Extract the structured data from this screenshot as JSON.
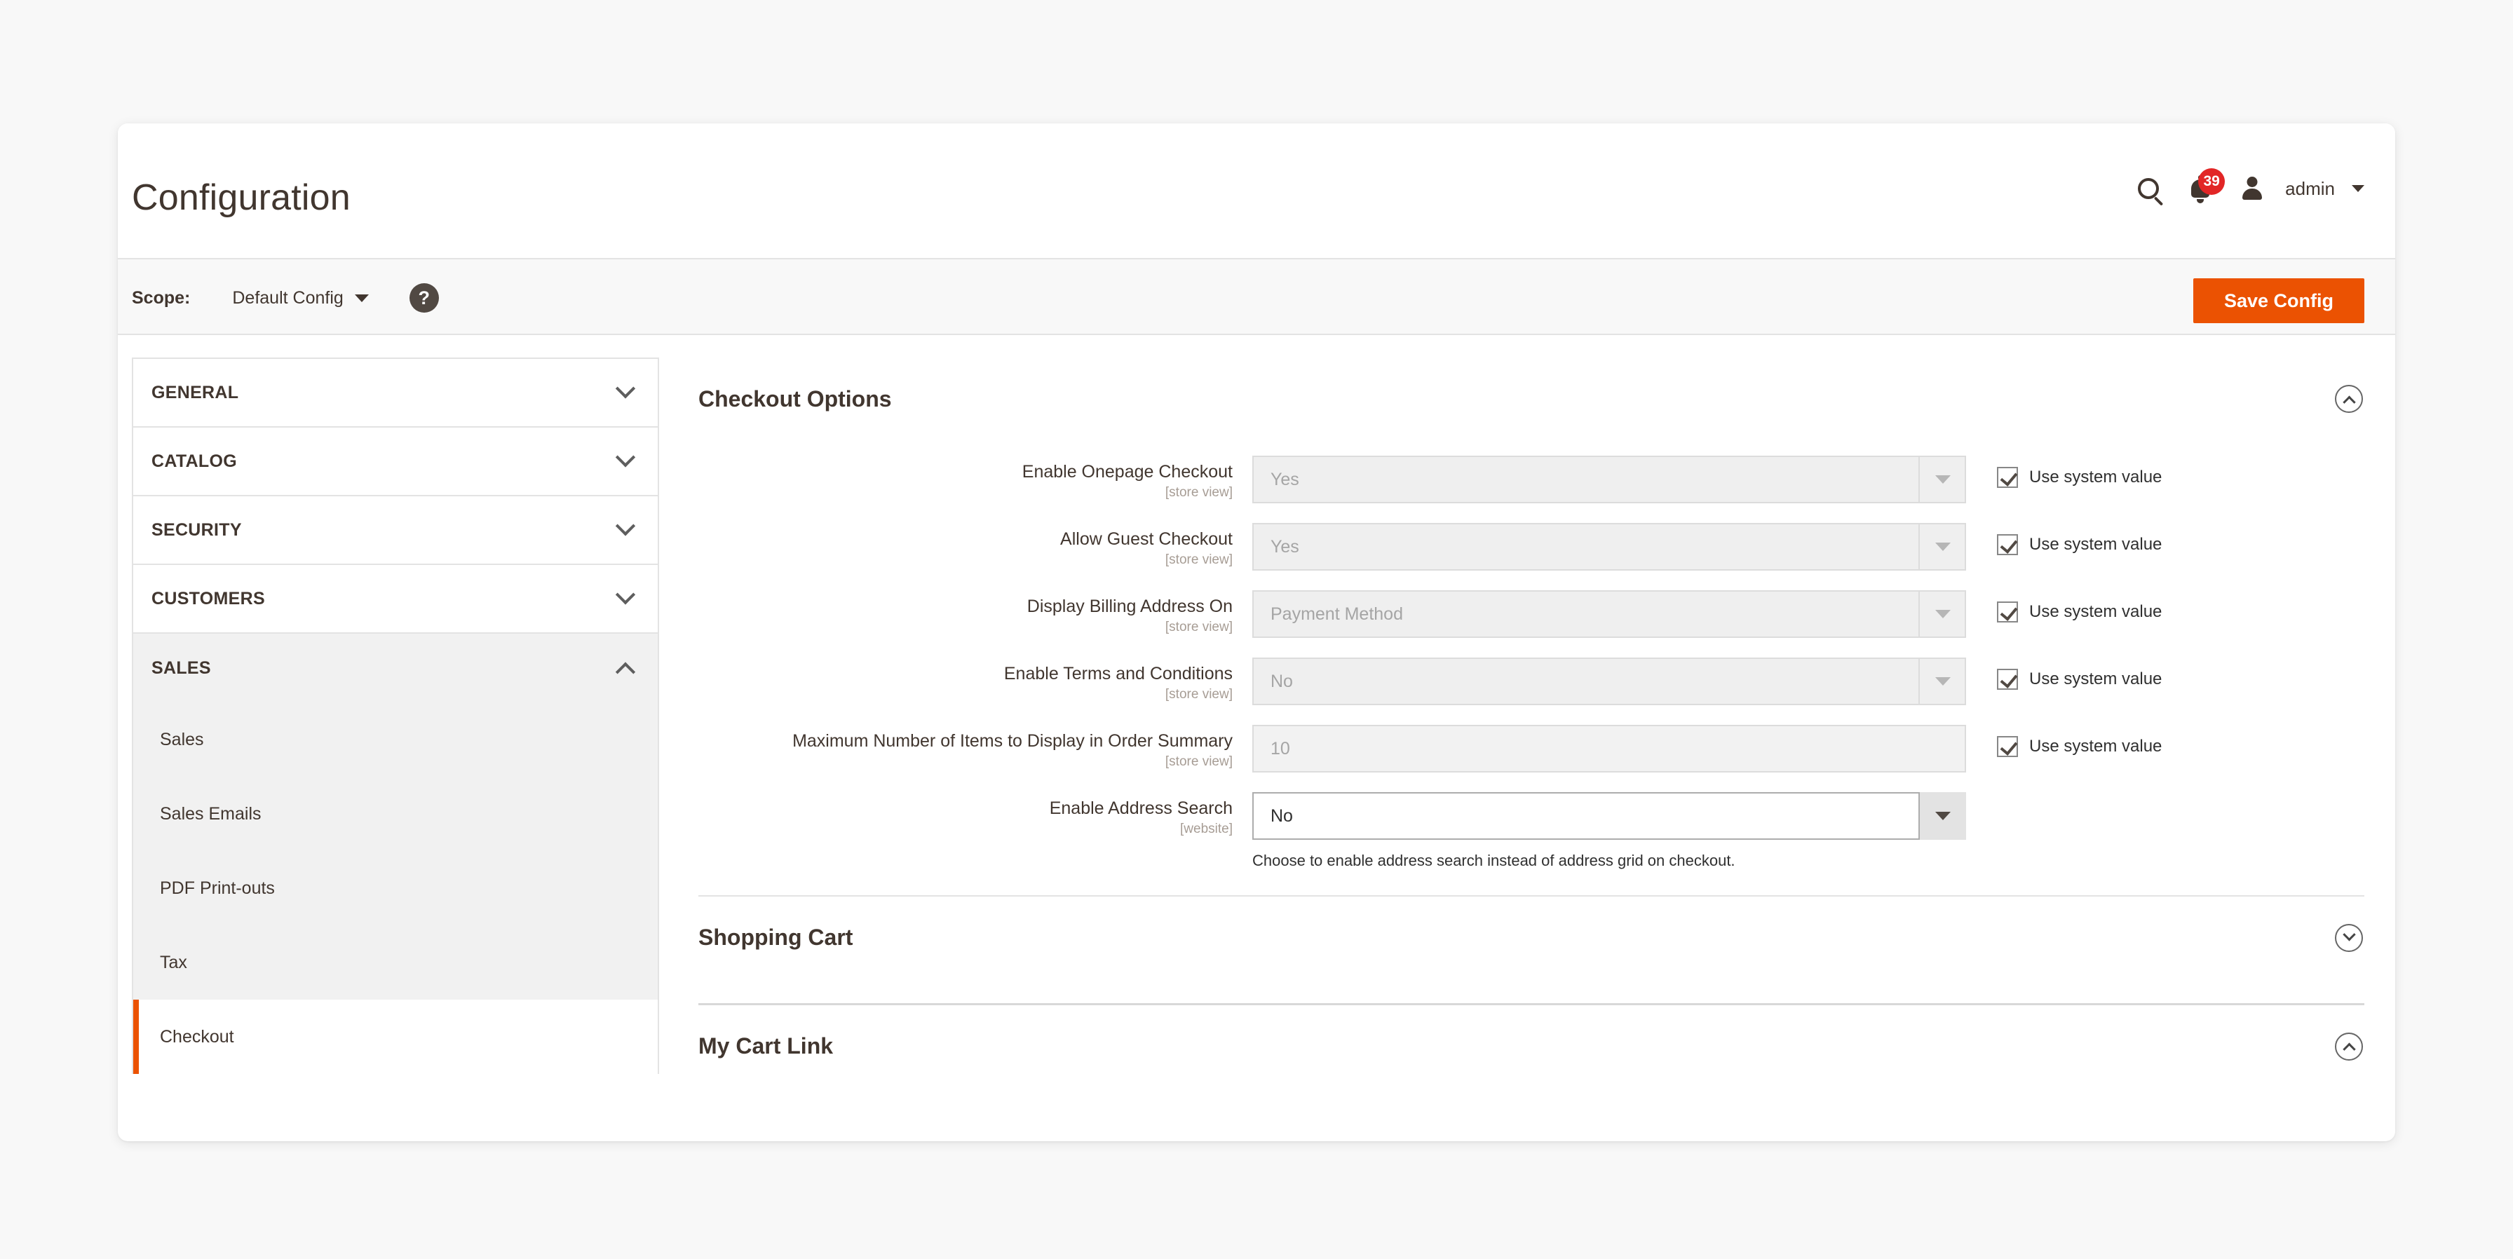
{
  "header": {
    "title": "Configuration",
    "search_icon": "search-icon",
    "notifications": {
      "icon": "bell-icon",
      "count": "39"
    },
    "user": {
      "avatar_icon": "user-avatar-icon",
      "name": "admin",
      "caret_icon": "chevron-down-icon"
    }
  },
  "scope_bar": {
    "label": "Scope:",
    "value": "Default Config",
    "caret_icon": "chevron-down-icon",
    "help_icon": "question-mark-icon",
    "help_glyph": "?",
    "save_label": "Save Config",
    "save_color": "#eb5202"
  },
  "sidebar": {
    "sections": [
      {
        "label": "GENERAL",
        "expanded": false,
        "chevron": "chevron-down-icon"
      },
      {
        "label": "CATALOG",
        "expanded": false,
        "chevron": "chevron-down-icon"
      },
      {
        "label": "SECURITY",
        "expanded": false,
        "chevron": "chevron-down-icon"
      },
      {
        "label": "CUSTOMERS",
        "expanded": false,
        "chevron": "chevron-down-icon"
      },
      {
        "label": "SALES",
        "expanded": true,
        "chevron": "chevron-up-icon"
      }
    ],
    "sub_items": [
      {
        "label": "Sales",
        "active": false
      },
      {
        "label": "Sales Emails",
        "active": false
      },
      {
        "label": "PDF Print-outs",
        "active": false
      },
      {
        "label": "Tax",
        "active": false
      },
      {
        "label": "Checkout",
        "active": true
      }
    ],
    "active_accent": "#eb5202"
  },
  "content": {
    "sections": [
      {
        "title": "Checkout Options",
        "expanded": true,
        "toggle_icon": "chevron-up-circle-icon"
      },
      {
        "title": "Shopping Cart",
        "expanded": false,
        "toggle_icon": "chevron-down-circle-icon"
      },
      {
        "title": "My Cart Link",
        "expanded": true,
        "toggle_icon": "chevron-up-circle-icon"
      }
    ],
    "fields": [
      {
        "label": "Enable Onepage Checkout",
        "scope": "[store view]",
        "type": "select",
        "value": "Yes",
        "disabled": true,
        "system_value_checked": true,
        "system_value_label": "Use system value",
        "note": ""
      },
      {
        "label": "Allow Guest Checkout",
        "scope": "[store view]",
        "type": "select",
        "value": "Yes",
        "disabled": true,
        "system_value_checked": true,
        "system_value_label": "Use system value",
        "note": ""
      },
      {
        "label": "Display Billing Address On",
        "scope": "[store view]",
        "type": "select",
        "value": "Payment Method",
        "disabled": true,
        "system_value_checked": true,
        "system_value_label": "Use system value",
        "note": ""
      },
      {
        "label": "Enable Terms and Conditions",
        "scope": "[store view]",
        "type": "select",
        "value": "No",
        "disabled": true,
        "system_value_checked": true,
        "system_value_label": "Use system value",
        "note": ""
      },
      {
        "label": "Maximum Number of Items to Display in Order Summary",
        "scope": "[store view]",
        "type": "text",
        "value": "10",
        "disabled": true,
        "system_value_checked": true,
        "system_value_label": "Use system value",
        "note": ""
      },
      {
        "label": "Enable Address Search",
        "scope": "[website]",
        "type": "select",
        "value": "No",
        "disabled": false,
        "system_value_checked": false,
        "system_value_label": "",
        "note": "Choose to enable address search instead of address grid on checkout."
      }
    ]
  }
}
